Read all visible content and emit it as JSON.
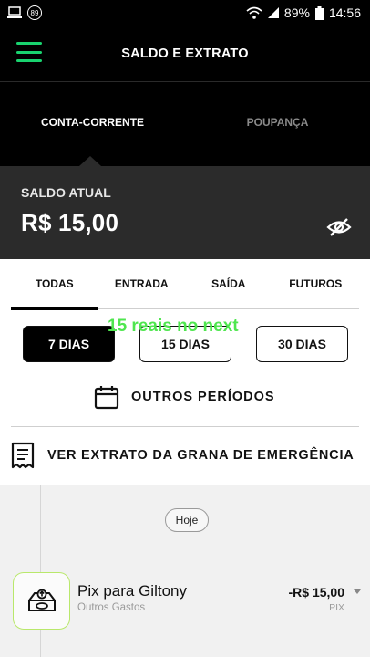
{
  "status_bar": {
    "notification_badge": "89",
    "battery_percent": "89%",
    "time": "14:56"
  },
  "header": {
    "title": "SALDO E EXTRATO",
    "accent_color": "#19d36f"
  },
  "account_tabs": [
    {
      "label": "CONTA-CORRENTE",
      "active": true
    },
    {
      "label": "POUPANÇA",
      "active": false
    }
  ],
  "balance": {
    "label": "SALDO ATUAL",
    "value": "R$ 15,00",
    "toggle_icon": "eye-off-icon"
  },
  "filter_tabs": [
    {
      "label": "TODAS",
      "active": true
    },
    {
      "label": "ENTRADA",
      "active": false
    },
    {
      "label": "SAÍDA",
      "active": false
    },
    {
      "label": "FUTUROS",
      "active": false
    }
  ],
  "periods": [
    {
      "label": "7 DIAS",
      "active": true
    },
    {
      "label": "15 DIAS",
      "active": false
    },
    {
      "label": "30 DIAS",
      "active": false
    }
  ],
  "overlay_text": "15 reais no next",
  "other_periods": {
    "label": "OUTROS PERÍODOS",
    "icon": "calendar-icon"
  },
  "emergency": {
    "label": "VER EXTRATO DA GRANA DE EMERGÊNCIA",
    "icon": "receipt-icon"
  },
  "date_pill": "Hoje",
  "transactions": [
    {
      "title": "Pix para Giltony",
      "category": "Outros Gastos",
      "amount": "-R$ 15,00",
      "type": "PIX",
      "icon": "pix-transfer-icon"
    }
  ]
}
